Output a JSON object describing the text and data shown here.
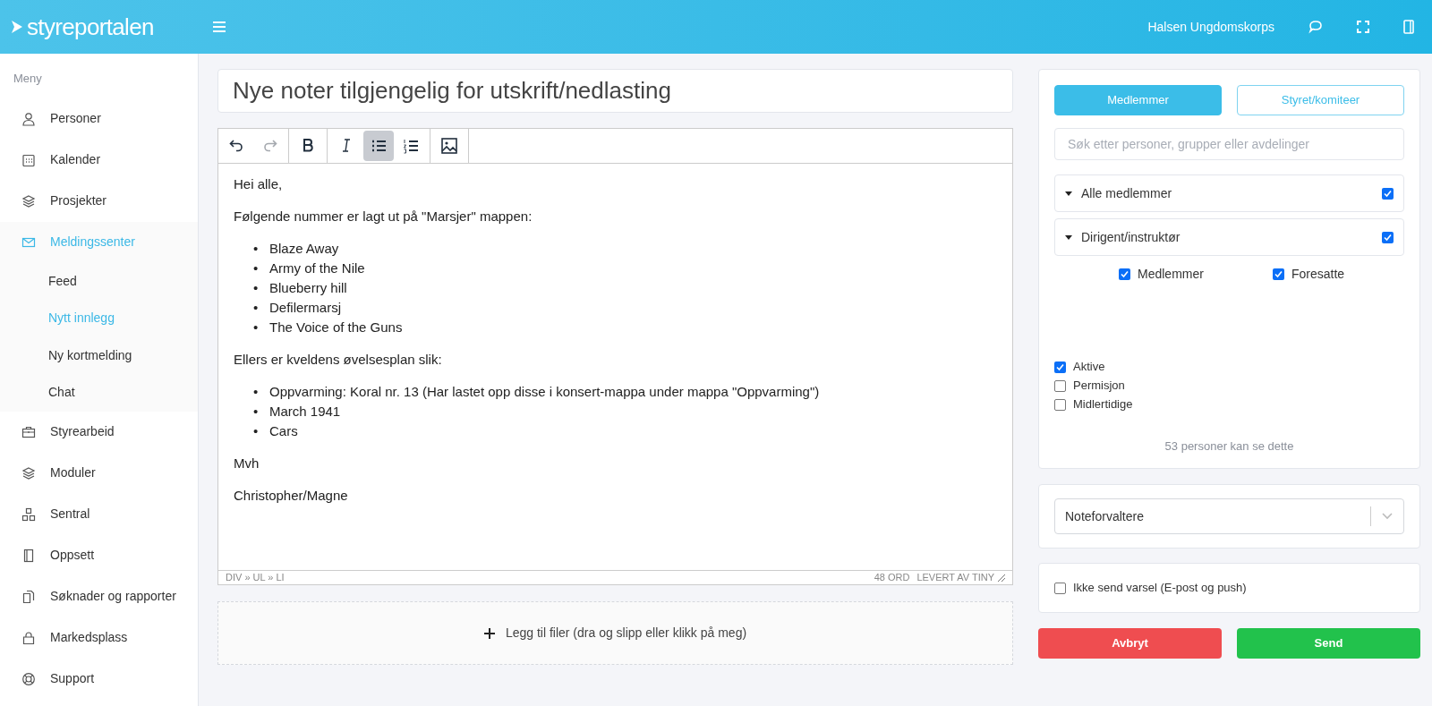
{
  "header": {
    "logo": "styreportalen",
    "organization": "Halsen Ungdomskorps"
  },
  "sidebar": {
    "heading": "Meny",
    "items": [
      {
        "label": "Personer",
        "selected": false
      },
      {
        "label": "Kalender",
        "selected": false
      },
      {
        "label": "Prosjekter",
        "selected": false
      },
      {
        "label": "Meldingssenter",
        "selected": true,
        "children": [
          {
            "label": "Feed",
            "selected": false
          },
          {
            "label": "Nytt innlegg",
            "selected": true
          },
          {
            "label": "Ny kortmelding",
            "selected": false
          },
          {
            "label": "Chat",
            "selected": false
          }
        ]
      },
      {
        "label": "Styrearbeid",
        "selected": false
      },
      {
        "label": "Moduler",
        "selected": false
      },
      {
        "label": "Sentral",
        "selected": false
      },
      {
        "label": "Oppsett",
        "selected": false
      },
      {
        "label": "Søknader og rapporter",
        "selected": false
      },
      {
        "label": "Markedsplass",
        "selected": false
      },
      {
        "label": "Support",
        "selected": false
      }
    ]
  },
  "editor": {
    "title": "Nye noter tilgjengelig for utskrift/nedlasting",
    "toolbar": [
      {
        "kind": "undo",
        "disabled": false,
        "active": false
      },
      {
        "kind": "redo",
        "disabled": true,
        "active": false
      },
      {
        "kind": "bold",
        "disabled": false,
        "active": false
      },
      {
        "kind": "italic",
        "disabled": false,
        "active": false
      },
      {
        "kind": "bullet-list",
        "disabled": false,
        "active": true
      },
      {
        "kind": "numbered-list",
        "disabled": false,
        "active": false
      },
      {
        "kind": "image",
        "disabled": false,
        "active": false
      }
    ],
    "content": [
      {
        "kind": "paragraph",
        "text": "Hei alle,"
      },
      {
        "kind": "paragraph",
        "text": "Følgende nummer er lagt ut på \"Marsjer\" mappen:"
      },
      {
        "kind": "list",
        "marker": "•",
        "items": [
          "Blaze Away",
          "Army of the Nile",
          "Blueberry hill",
          "Defilermarsj",
          "The Voice of the Guns"
        ]
      },
      {
        "kind": "paragraph",
        "text": "Ellers er kveldens øvelsesplan slik:"
      },
      {
        "kind": "list",
        "marker": "•",
        "items": [
          "Oppvarming: Koral nr. 13 (Har lastet opp disse i konsert-mappa under mappa \"Oppvarming\")",
          "March 1941",
          "Cars"
        ]
      },
      {
        "kind": "paragraph",
        "text": "Mvh"
      },
      {
        "kind": "paragraph",
        "text": "Christopher/Magne"
      }
    ],
    "status_path": "DIV » UL » LI",
    "word_count": "48 ORD",
    "powered_by": "LEVERT AV TINY"
  },
  "upload": {
    "label": "Legg til filer (dra og slipp eller klikk på meg)"
  },
  "recipients": {
    "tabs": [
      {
        "label": "Medlemmer",
        "selected": true
      },
      {
        "label": "Styret/komiteer",
        "selected": false
      }
    ],
    "search": {
      "placeholder": "Søk etter personer, grupper eller avdelinger"
    },
    "groups": [
      {
        "label": "Alle medlemmer",
        "checked": true,
        "expanded": true
      },
      {
        "label": "Dirigent/instruktør",
        "checked": true,
        "expanded": true
      }
    ],
    "roles": [
      {
        "label": "Medlemmer",
        "checked": true
      },
      {
        "label": "Foresatte",
        "checked": true
      }
    ],
    "statuses": [
      {
        "label": "Aktive",
        "checked": true
      },
      {
        "label": "Permisjon",
        "checked": false
      },
      {
        "label": "Midlertidige",
        "checked": false
      }
    ],
    "count": "53 personer kan se dette"
  },
  "role_select": {
    "value": "Noteforvaltere"
  },
  "notify": {
    "label": "Ikke send varsel (E-post og push)",
    "checked": false
  },
  "buttons": [
    {
      "kind": "cancel",
      "label": "Avbryt"
    },
    {
      "kind": "send",
      "label": "Send"
    }
  ]
}
